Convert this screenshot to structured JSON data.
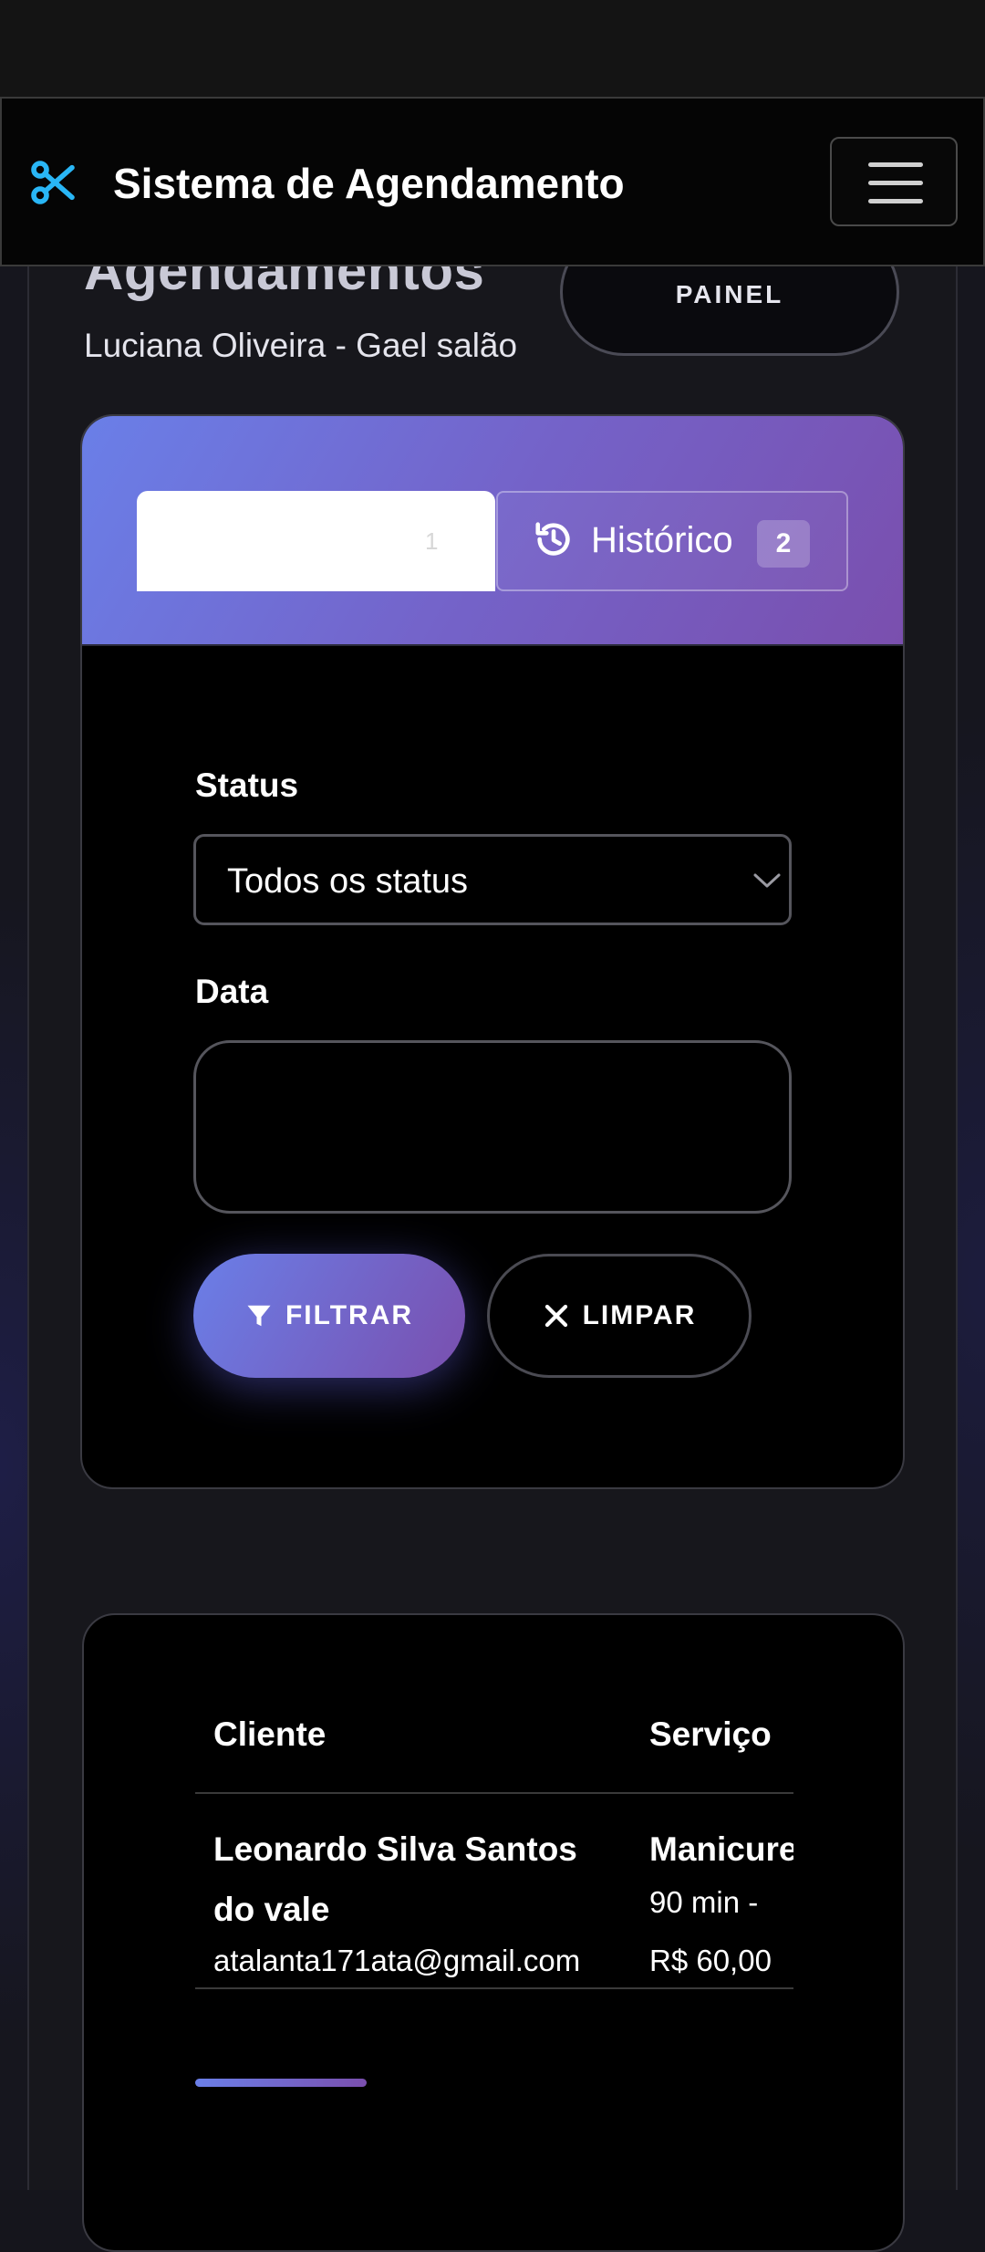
{
  "header": {
    "title": "Agendamentos",
    "subtitle": "Luciana Oliveira - Gael salão",
    "panel_button": "PAINEL"
  },
  "navbar": {
    "brand_icon": "scissors-icon",
    "brand_title": "Sistema de Agendamento",
    "menu_icon": "hamburger-icon"
  },
  "tabs": [
    {
      "label": "",
      "badge": "1",
      "active": true
    },
    {
      "label": "Histórico",
      "badge": "2",
      "icon": "history-icon",
      "active": false
    }
  ],
  "filters": {
    "status_label": "Status",
    "status_value": "Todos os status",
    "date_label": "Data",
    "date_value": "",
    "filter_button": "FILTRAR",
    "clear_button": "LIMPAR"
  },
  "table": {
    "columns": [
      "Cliente",
      "Serviço"
    ],
    "rows": [
      {
        "client_name": "Leonardo Silva Santos do vale",
        "client_email": "atalanta171ata@gmail.com",
        "service": "Manicure",
        "duration": "90 min -",
        "price": "R$ 60,00"
      }
    ]
  },
  "colors": {
    "accent_start": "#6a7fe8",
    "accent_end": "#7a4fae",
    "brand_icon": "#29b6f6"
  }
}
